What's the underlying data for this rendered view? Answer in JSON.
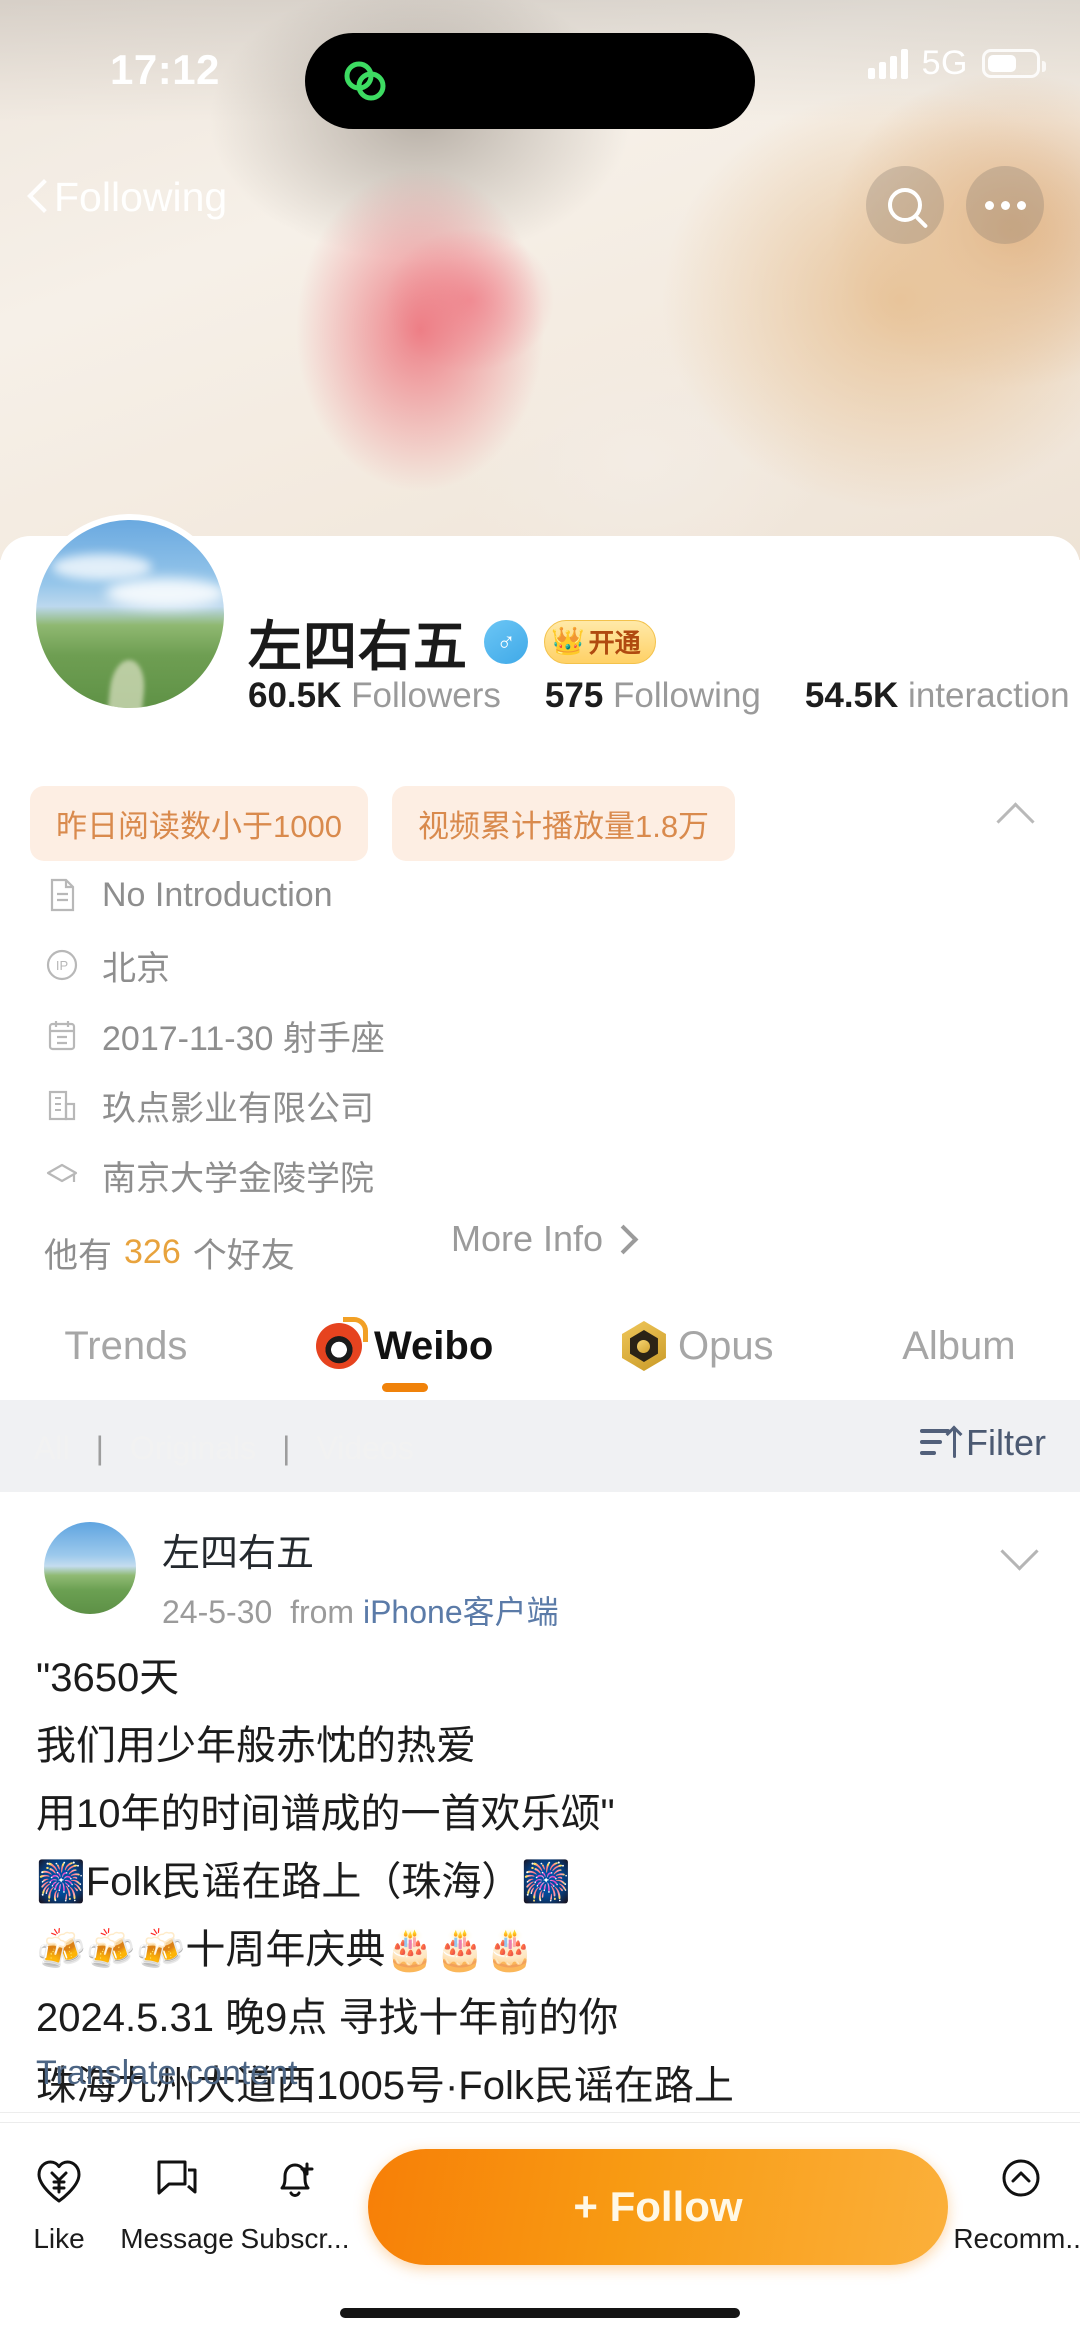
{
  "status_bar": {
    "time": "17:12",
    "network": "5G",
    "signal_bars": 4,
    "battery_level": "54%"
  },
  "nav": {
    "back_label": "Following",
    "search_icon": "search-icon",
    "more_icon": "more-dots-icon"
  },
  "profile": {
    "name": "左四右五",
    "gender_symbol": "♂",
    "vip_badge": {
      "crown": "👑",
      "label": "开通"
    },
    "stats": [
      {
        "value": "60.5K",
        "label": "Followers"
      },
      {
        "value": "575",
        "label": "Following"
      },
      {
        "value": "54.5K",
        "label": "interaction"
      }
    ],
    "pills": [
      "昨日阅读数小于1000",
      "视频累计播放量1.8万"
    ],
    "collapse_icon": "chevron-up-icon",
    "info_rows": [
      {
        "icon": "document-icon",
        "text": "No Introduction"
      },
      {
        "icon": "ip-location-icon",
        "text": "北京"
      },
      {
        "icon": "calendar-icon",
        "text": "2017-11-30 射手座"
      },
      {
        "icon": "company-icon",
        "text": "玖点影业有限公司"
      },
      {
        "icon": "education-icon",
        "text": "南京大学金陵学院"
      }
    ],
    "friends": {
      "prefix": "他有",
      "count": "326",
      "suffix": "个好友"
    },
    "more_info_label": "More Info"
  },
  "tabs": [
    {
      "id": "trends",
      "label": "Trends",
      "icon": null,
      "active": false
    },
    {
      "id": "weibo",
      "label": "Weibo",
      "icon": "weibo-logo-icon",
      "active": true
    },
    {
      "id": "opus",
      "label": "Opus",
      "icon": "opus-badge-icon",
      "active": false
    },
    {
      "id": "album",
      "label": "Album",
      "icon": null,
      "active": false
    }
  ],
  "filter_bar": {
    "ghost_items": [
      "All",
      "|",
      "Originals",
      "|",
      "Videos"
    ],
    "filter_label": "Filter",
    "filter_icon": "sort-filter-icon"
  },
  "post": {
    "author": "左四右五",
    "date": "24-5-30",
    "from_prefix": "from",
    "source": "iPhone客户端",
    "expand_icon": "chevron-down-icon",
    "lines": [
      "\"3650天",
      "我们用少年般赤忱的热爱",
      "用10年的时间谱成的一首欢乐颂\"",
      "🎆Folk民谣在路上（珠海）🎆",
      "🍻🍻🍻十周年庆典🎂🎂🎂",
      "2024.5.31 晚9点 寻找十年前的你",
      "珠海九州大道西1005号·Folk民谣在路上"
    ],
    "translate_label": "Translate content"
  },
  "bottom_bar": {
    "actions": [
      {
        "id": "like",
        "label": "Like",
        "icon": "heart-yuan-icon"
      },
      {
        "id": "message",
        "label": "Message",
        "icon": "message-icon"
      },
      {
        "id": "subscribe",
        "label": "Subscr...",
        "icon": "bell-plus-icon"
      }
    ],
    "follow_label": "+ Follow",
    "recommend": {
      "label": "Recomm...",
      "icon": "chevron-up-circle-icon"
    }
  },
  "colors": {
    "accent_orange": "#f0820a",
    "follow_gradient_start": "#f77f07",
    "follow_gradient_end": "#fbb03b",
    "pill_bg": "#fdeee3",
    "pill_text": "#d98a4d",
    "link_blue": "#4c6584",
    "friends_count": "#e8a33d"
  }
}
